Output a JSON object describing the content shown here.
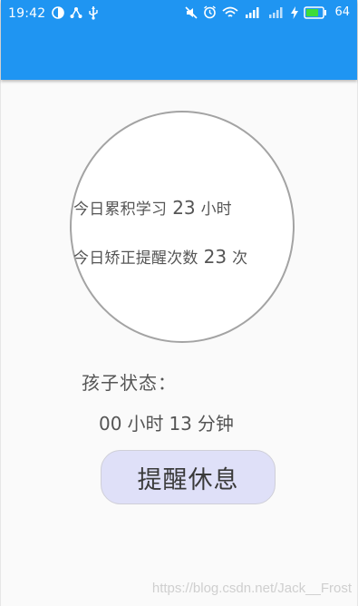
{
  "status_bar": {
    "time": "19:42",
    "battery_level": "64"
  },
  "stats": {
    "study_label": "今日累积学习",
    "study_value": "23",
    "study_unit": "小时",
    "reminder_label": "今日矫正提醒次数",
    "reminder_value": "23",
    "reminder_unit": "次"
  },
  "child_status": {
    "label": "孩子状态：",
    "hours_value": "00",
    "hours_unit": "小时",
    "minutes_value": "13",
    "minutes_unit": "分钟"
  },
  "actions": {
    "remind_rest_label": "提醒休息"
  },
  "watermark": "https://blog.csdn.net/Jack__Frost",
  "colors": {
    "app_bar": "#1f95f2",
    "button_bg": "#dfe0f8",
    "circle_border": "#a3a3a3"
  }
}
